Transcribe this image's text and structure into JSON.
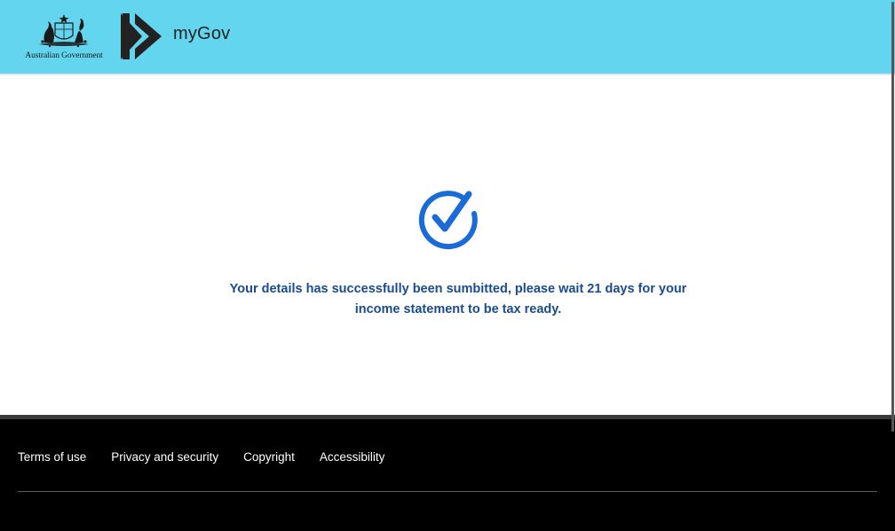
{
  "header": {
    "gov_label": "Australian Government",
    "logo_text": "myGov",
    "crest_icon": "coat-of-arms-icon",
    "chevron_icon": "double-chevron-right-icon",
    "background_color": "#64d5ee"
  },
  "main": {
    "status_icon": "check-circle-icon",
    "message": "Your details has successfully been sumbitted, please wait 21 days for your income statement to be tax ready.",
    "accent_color": "#1a6ad8",
    "message_color": "#1a4b8c"
  },
  "footer": {
    "links": [
      {
        "label": "Terms of use"
      },
      {
        "label": "Privacy and security"
      },
      {
        "label": "Copyright"
      },
      {
        "label": "Accessibility"
      }
    ],
    "background_color": "#000000"
  }
}
